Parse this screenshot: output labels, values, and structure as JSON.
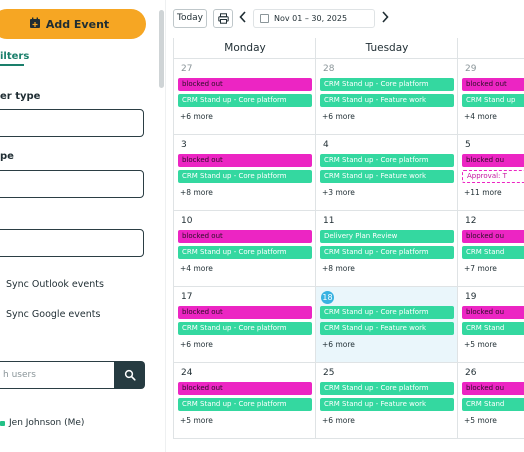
{
  "sidebar": {
    "add_event_label": "Add Event",
    "filters_tab": "ilters",
    "user_type_label": "er type",
    "type_label": "pe",
    "sync_outlook_label": "Sync Outlook events",
    "sync_google_label": "Sync Google events",
    "search_placeholder": "h users",
    "user_name": "Jen Johnson (Me)"
  },
  "toolbar": {
    "today_label": "Today",
    "prev_icon": "chevron-left-icon",
    "next_icon": "chevron-right-icon",
    "date_range": "Nov 01 – 30, 2025"
  },
  "calendar": {
    "day_headers": [
      "Monday",
      "Tuesday",
      "W"
    ],
    "weeks": [
      {
        "days": [
          {
            "num": "27",
            "muted": true,
            "events": [
              {
                "label": "blocked out",
                "color": "pink"
              },
              {
                "label": "CRM Stand up - Core platform",
                "color": "green"
              }
            ],
            "more": "+6 more"
          },
          {
            "num": "28",
            "muted": true,
            "events": [
              {
                "label": "CRM Stand up - Core platform",
                "color": "green"
              },
              {
                "label": "CRM Stand up - Feature work",
                "color": "green"
              }
            ],
            "more": "+6 more"
          },
          {
            "num": "29",
            "muted": true,
            "events": [
              {
                "label": "blocked out",
                "color": "pink"
              },
              {
                "label": "CRM Stand up",
                "color": "green"
              }
            ],
            "more": "+4 more"
          }
        ]
      },
      {
        "days": [
          {
            "num": "3",
            "events": [
              {
                "label": "blocked out",
                "color": "pink"
              },
              {
                "label": "CRM Stand up - Core platform",
                "color": "green"
              }
            ],
            "more": "+8 more"
          },
          {
            "num": "4",
            "events": [
              {
                "label": "CRM Stand up - Core platform",
                "color": "green"
              },
              {
                "label": "CRM Stand up - Feature work",
                "color": "green"
              }
            ],
            "more": "+3 more"
          },
          {
            "num": "5",
            "events": [
              {
                "label": "blocked ou",
                "color": "pink"
              },
              {
                "label": "Approval: T",
                "color": "approval"
              }
            ],
            "more": "+11 more"
          }
        ]
      },
      {
        "days": [
          {
            "num": "10",
            "events": [
              {
                "label": "blocked out",
                "color": "pink"
              },
              {
                "label": "CRM Stand up - Core platform",
                "color": "green"
              }
            ],
            "more": "+4 more"
          },
          {
            "num": "11",
            "events": [
              {
                "label": "Delivery Plan Review",
                "color": "green"
              },
              {
                "label": "CRM Stand up - Core platform",
                "color": "green"
              }
            ],
            "more": "+8 more"
          },
          {
            "num": "12",
            "events": [
              {
                "label": "blocked ou",
                "color": "pink"
              },
              {
                "label": "CRM Stand",
                "color": "green"
              }
            ],
            "more": "+7 more"
          }
        ]
      },
      {
        "days": [
          {
            "num": "17",
            "events": [
              {
                "label": "blocked out",
                "color": "pink"
              },
              {
                "label": "CRM Stand up - Core platform",
                "color": "green"
              }
            ],
            "more": "+6 more"
          },
          {
            "num": "18",
            "today": true,
            "events": [
              {
                "label": "CRM Stand up - Core platform",
                "color": "green"
              },
              {
                "label": "CRM Stand up - Feature work",
                "color": "green"
              }
            ],
            "more": "+6 more"
          },
          {
            "num": "19",
            "events": [
              {
                "label": "blocked ou",
                "color": "pink"
              },
              {
                "label": "CRM Stand",
                "color": "green"
              }
            ],
            "more": "+5 more"
          }
        ]
      },
      {
        "days": [
          {
            "num": "24",
            "events": [
              {
                "label": "blocked out",
                "color": "pink"
              },
              {
                "label": "CRM Stand up - Core platform",
                "color": "green"
              }
            ],
            "more": "+5 more"
          },
          {
            "num": "25",
            "events": [
              {
                "label": "CRM Stand up - Core platform",
                "color": "green"
              },
              {
                "label": "CRM Stand up - Feature work",
                "color": "green"
              }
            ],
            "more": "+6 more"
          },
          {
            "num": "26",
            "events": [
              {
                "label": "blocked ou",
                "color": "pink"
              },
              {
                "label": "CRM Stand",
                "color": "green"
              }
            ],
            "more": "+5 more"
          }
        ]
      }
    ]
  },
  "colors": {
    "accent": "#f6a623",
    "event_pink": "#ec25c3",
    "event_green": "#34d8a0",
    "today_bg": "#eaf6fb",
    "today_badge": "#38b2e1",
    "filters_green": "#1a7f6b"
  }
}
